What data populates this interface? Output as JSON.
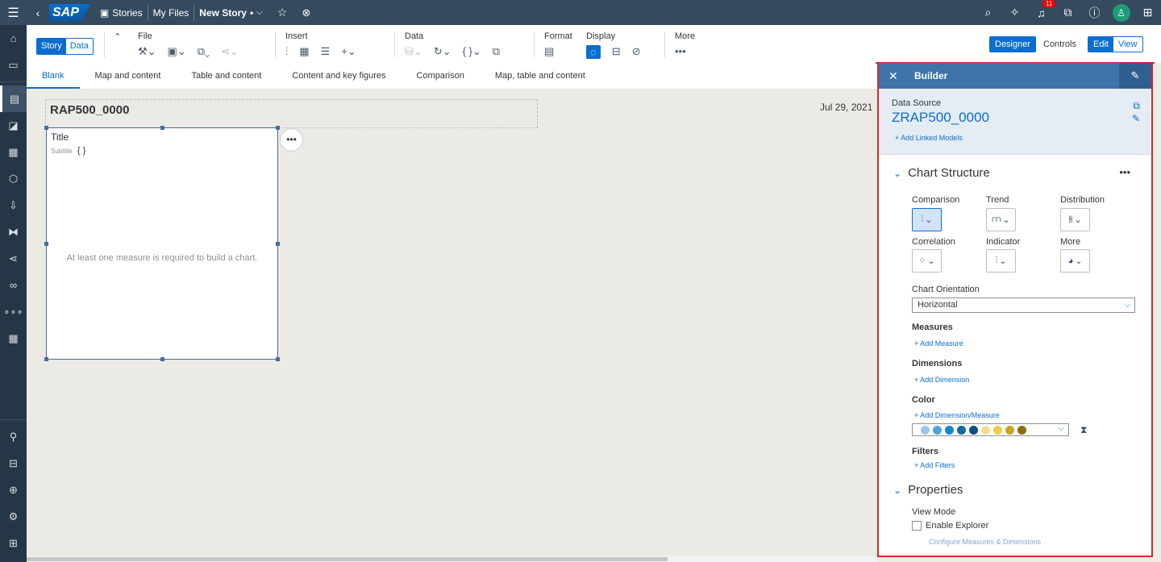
{
  "shell": {
    "logo": "SAP",
    "stories": "Stories",
    "my_files": "My Files",
    "new_story": "New Story",
    "new_story_marker": "•",
    "notifications_count": "11"
  },
  "toolbar": {
    "story": "Story",
    "data": "Data",
    "file": "File",
    "insert": "Insert",
    "data_group": "Data",
    "format": "Format",
    "display": "Display",
    "more": "More",
    "designer": "Designer",
    "controls": "Controls",
    "edit": "Edit",
    "view": "View"
  },
  "tabs": [
    "Blank",
    "Map and content",
    "Table and content",
    "Content and key figures",
    "Comparison",
    "Map, table and content"
  ],
  "canvas": {
    "story_title": "RAP500_0000",
    "date": "Jul 29, 2021",
    "widget_title": "Title",
    "widget_subtitle": "Subtitle",
    "widget_braces": "{ }",
    "widget_message": "At least one measure is required to build a chart."
  },
  "builder": {
    "title": "Builder",
    "data_source_label": "Data Source",
    "data_source_name": "ZRAP500_0000",
    "add_linked_models": "Add Linked Models",
    "chart_structure": "Chart Structure",
    "types": [
      "Comparison",
      "Trend",
      "Distribution",
      "Correlation",
      "Indicator",
      "More"
    ],
    "chart_orientation_label": "Chart Orientation",
    "chart_orientation_value": "Horizontal",
    "measures": "Measures",
    "add_measure": "Add Measure",
    "dimensions": "Dimensions",
    "add_dimension": "Add Dimension",
    "color": "Color",
    "add_dimension_measure": "Add Dimension/Measure",
    "palette": [
      "#9fc5e8",
      "#4fa3dc",
      "#1a86c4",
      "#136aa0",
      "#0c4f7a",
      "#f6dc8f",
      "#f2c94c",
      "#c9a227",
      "#8a6d12"
    ],
    "filters": "Filters",
    "add_filters": "Add Filters",
    "properties": "Properties",
    "view_mode": "View Mode",
    "enable_explorer": "Enable Explorer",
    "configure": "Configure Measures & Dimensions"
  }
}
